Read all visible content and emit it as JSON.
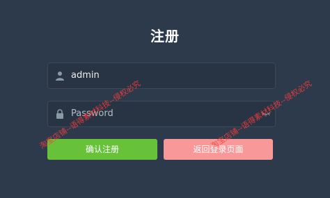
{
  "form": {
    "title": "注册",
    "username": {
      "value": "admin",
      "icon": "user-icon"
    },
    "password": {
      "placeholder": "Password",
      "icon": "lock-icon",
      "toggle_icon": "eye-closed-icon"
    },
    "buttons": {
      "confirm_label": "确认注册",
      "back_label": "返回登录页面"
    }
  },
  "watermark": {
    "text": "淘宝店铺--语得素材科技--侵权必究"
  },
  "colors": {
    "background": "#2d3a4b",
    "confirm_button": "#67c23a",
    "back_button": "#f89898",
    "watermark": "#ff3c3c"
  }
}
